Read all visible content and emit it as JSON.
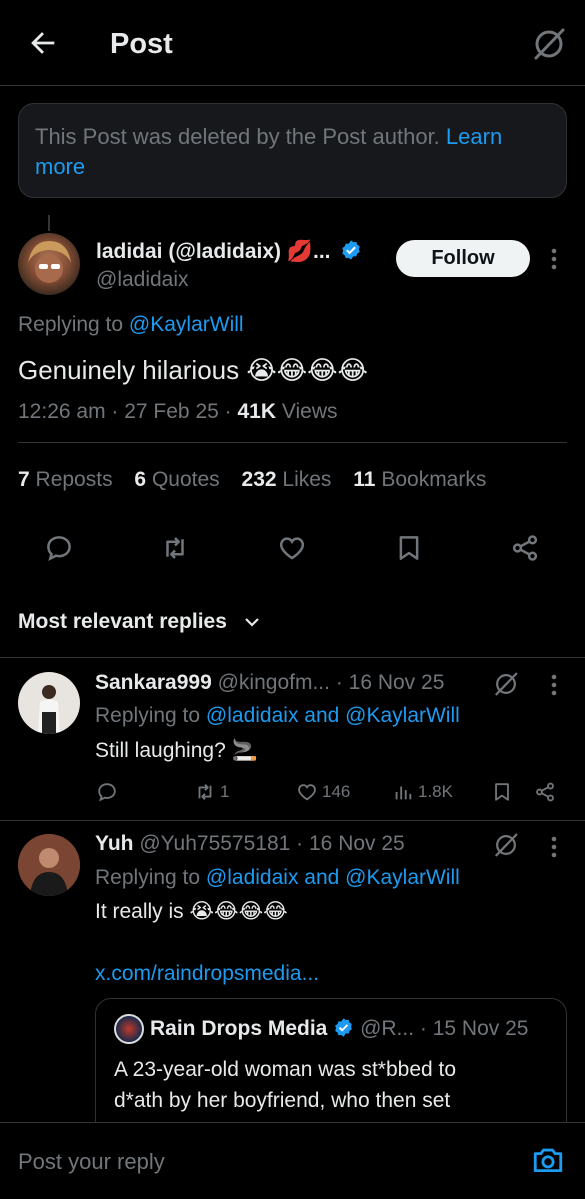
{
  "header": {
    "title": "Post"
  },
  "deleted_notice": {
    "text": "This Post was deleted by the Post author.",
    "link": "Learn more"
  },
  "main_post": {
    "display_name": "ladidai (@ladidaix) 💋...",
    "handle": "@ladidaix",
    "follow_label": "Follow",
    "replying_prefix": "Replying to",
    "replying_to": "@KaylarWill",
    "text": "Genuinely hilarious 😭😂😂😂",
    "time": "12:26 am",
    "date": "27 Feb 25",
    "views_count": "41K",
    "views_label": "Views",
    "stats": {
      "reposts_count": "7",
      "reposts_label": "Reposts",
      "quotes_count": "6",
      "quotes_label": "Quotes",
      "likes_count": "232",
      "likes_label": "Likes",
      "bookmarks_count": "11",
      "bookmarks_label": "Bookmarks"
    },
    "actions": [
      "reply-icon",
      "repost-icon",
      "like-icon",
      "bookmark-icon",
      "share-icon"
    ]
  },
  "replies_header": {
    "label": "Most relevant replies"
  },
  "replies": [
    {
      "name": "Sankara999",
      "handle": "@kingofm...",
      "date": "· 16 Nov 25",
      "replying_prefix": "Replying to",
      "replying_to": "@ladidaix and @KaylarWill",
      "text": "Still laughing? 🚬",
      "reposts": "1",
      "likes": "146",
      "views": "1.8K"
    },
    {
      "name": "Yuh",
      "handle": "@Yuh75575181",
      "date": "· 16 Nov 25",
      "replying_prefix": "Replying to",
      "replying_to": "@ladidaix and @KaylarWill",
      "text": "It really is 😭😂😂😂",
      "link": "x.com/raindropsmedia...",
      "quote": {
        "name": "Rain Drops Media",
        "handle": "@R...",
        "date": "· 15 Nov 25",
        "text_line1": "A 23-year-old woman was st*bbed to",
        "text_line2": "d*ath by her boyfriend, who then set"
      }
    }
  ],
  "reply_bar": {
    "placeholder": "Post your reply"
  },
  "colors": {
    "background": "#000000",
    "text": "#e7e9ea",
    "muted": "#71767b",
    "accent": "#1d9bf0",
    "divider": "#2f3336"
  }
}
